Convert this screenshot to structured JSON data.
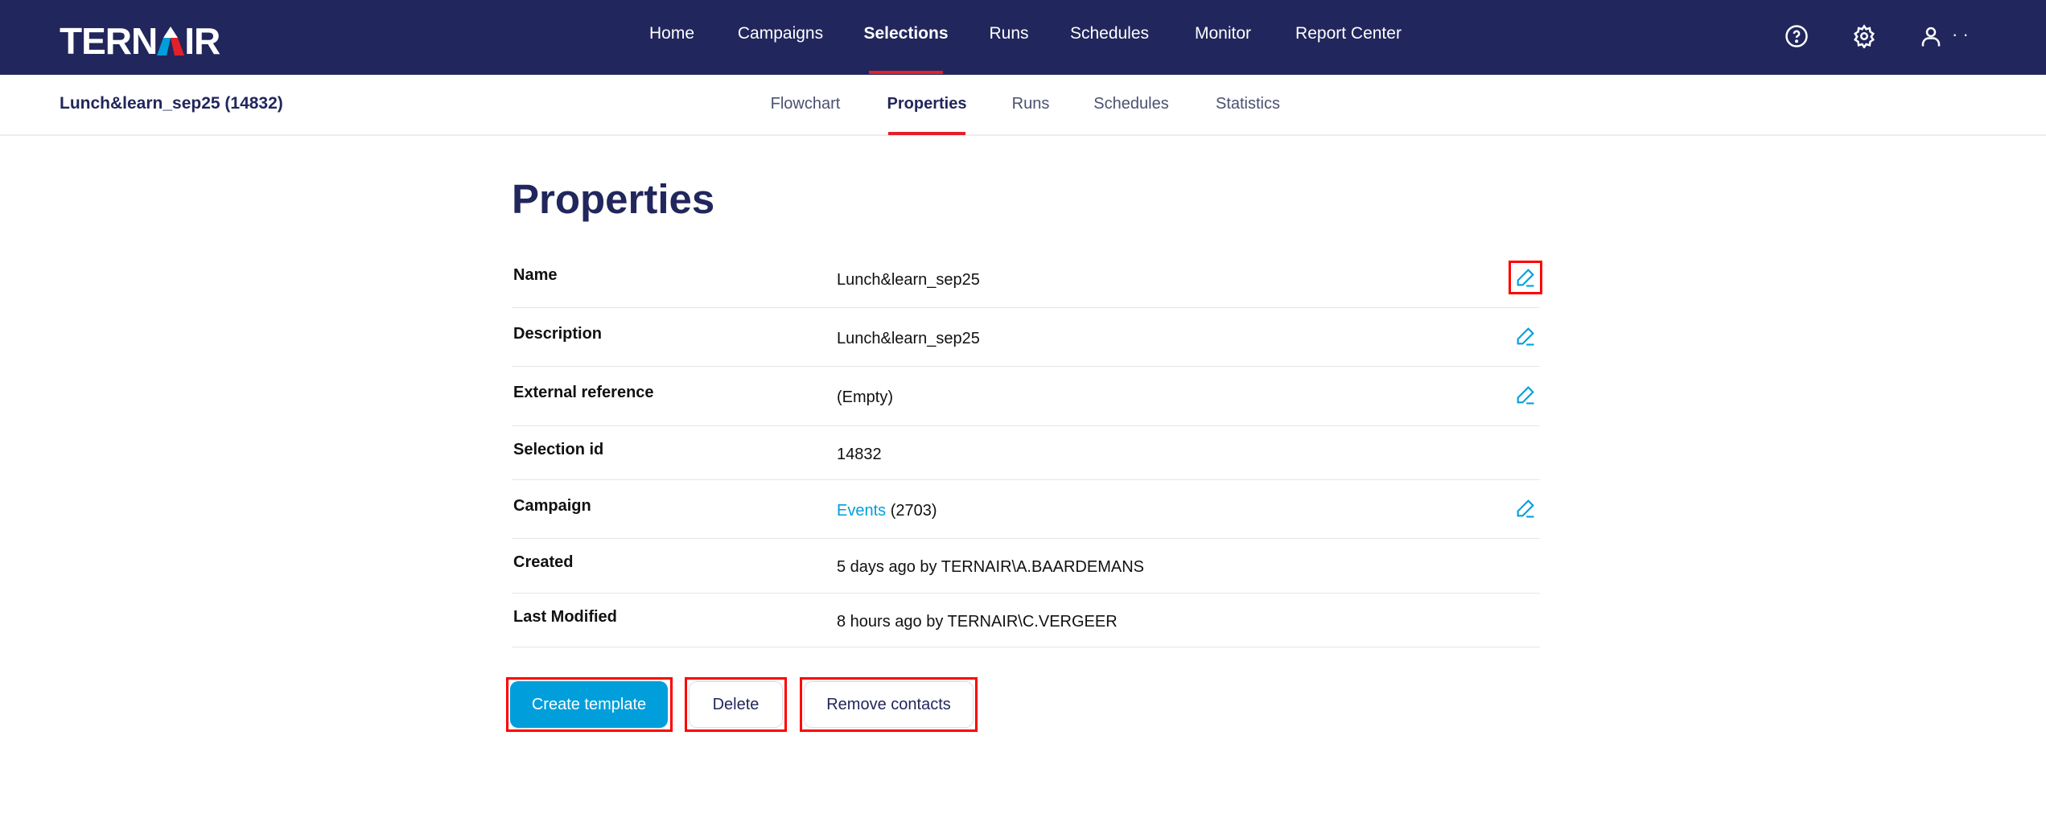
{
  "brand": "TERNAIR",
  "nav": {
    "items": [
      "Home",
      "Campaigns",
      "Selections",
      "Runs",
      "Schedules",
      "Monitor",
      "Report Center"
    ],
    "active": "Selections"
  },
  "header_icons": {
    "help": "help-circle-icon",
    "settings": "gear-icon",
    "user": "user-icon",
    "user_name": "· ·"
  },
  "subnav": {
    "breadcrumb": "Lunch&learn_sep25 (14832)",
    "tabs": [
      "Flowchart",
      "Properties",
      "Runs",
      "Schedules",
      "Statistics"
    ],
    "active": "Properties"
  },
  "page": {
    "title": "Properties",
    "rows": [
      {
        "label": "Name",
        "value": "Lunch&learn_sep25",
        "editable": true
      },
      {
        "label": "Description",
        "value": "Lunch&learn_sep25",
        "editable": true
      },
      {
        "label": "External reference",
        "value": "(Empty)",
        "editable": true
      },
      {
        "label": "Selection id",
        "value": "14832",
        "editable": false
      },
      {
        "label": "Campaign",
        "link": "Events",
        "value": " (2703)",
        "editable": true
      },
      {
        "label": "Created",
        "value": "5 days ago by TERNAIR\\A.BAARDEMANS",
        "editable": false
      },
      {
        "label": "Last Modified",
        "value": "8 hours ago by TERNAIR\\C.VERGEER",
        "editable": false
      }
    ],
    "buttons": {
      "create_template": "Create template",
      "delete": "Delete",
      "remove_contacts": "Remove contacts"
    }
  },
  "colors": {
    "navy": "#21275c",
    "accent": "#009fdb",
    "red": "#e3202a"
  }
}
